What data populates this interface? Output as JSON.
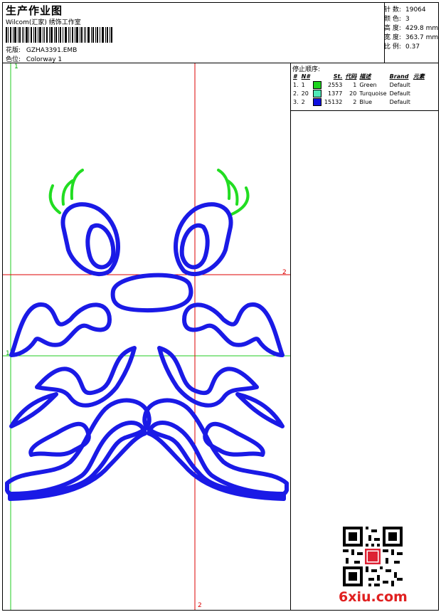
{
  "header": {
    "title": "生产作业图",
    "studio": "Wilcom(汇家) 绣饰工作室",
    "design_label": "花版:",
    "design_value": "GZHA3391.EMB",
    "colorway_label": "色位:",
    "colorway_value": "Colorway 1"
  },
  "stats": [
    {
      "label": "针 数:",
      "value": "19064"
    },
    {
      "label": "颜 色:",
      "value": "3"
    },
    {
      "label": "高 度:",
      "value": "429.8 mm"
    },
    {
      "label": "宽 度:",
      "value": "363.7 mm"
    },
    {
      "label": "比 例:",
      "value": "0.37"
    }
  ],
  "stop_sequence": {
    "title": "停止顺序:",
    "columns": [
      "#",
      "N#",
      "St.",
      "代码",
      "描述",
      "Brand",
      "元素"
    ],
    "rows": [
      {
        "idx": "1.",
        "n": "1",
        "color": "#1ed41e",
        "st": "2553",
        "code": "1",
        "desc": "Green",
        "brand": "Default"
      },
      {
        "idx": "2.",
        "n": "20",
        "color": "#4fe8b8",
        "st": "1377",
        "code": "20",
        "desc": "Turquoise",
        "brand": "Default"
      },
      {
        "idx": "3.",
        "n": "2",
        "color": "#1010e0",
        "st": "15132",
        "code": "2",
        "desc": "Blue",
        "brand": "Default"
      }
    ]
  },
  "canvas_marks": {
    "top_green": "1",
    "right_red": "2",
    "bottom_red": "2",
    "left_green": "1"
  },
  "colors": {
    "green": "#22dd22",
    "blue": "#1a1ae6",
    "guide_red": "#dd0000",
    "guide_green": "#22cc22"
  },
  "watermark": {
    "site": "6xiu.com"
  }
}
